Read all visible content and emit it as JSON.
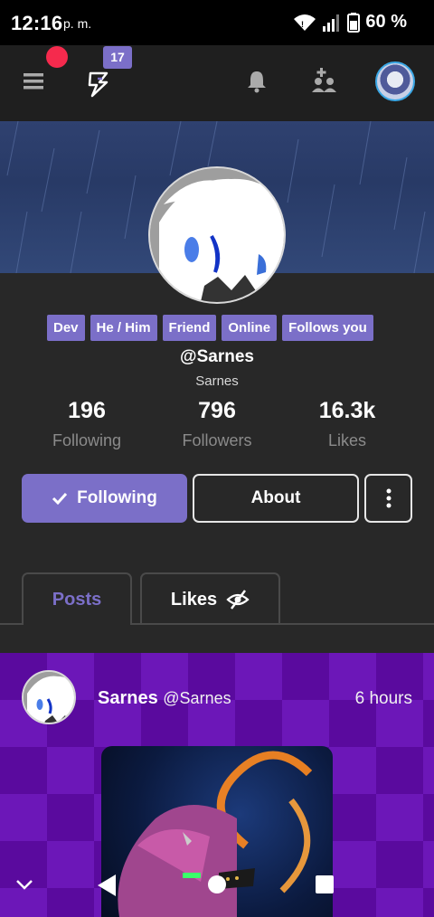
{
  "status_bar": {
    "time": "12:16",
    "ampm": "p. m.",
    "battery": "60 %",
    "icons": [
      "wifi-icon",
      "signal-icon",
      "battery-icon"
    ]
  },
  "topbar": {
    "notification_count": "17",
    "icons": [
      "menu-icon",
      "lightning-icon",
      "bell-icon",
      "add-user-icon",
      "avatar"
    ]
  },
  "profile": {
    "tags": [
      "Dev",
      "He / Him",
      "Friend",
      "Online",
      "Follows you"
    ],
    "handle": "@Sarnes",
    "display_name": "Sarnes",
    "stats": [
      {
        "value": "196",
        "label": "Following"
      },
      {
        "value": "796",
        "label": "Followers"
      },
      {
        "value": "16.3k",
        "label": "Likes"
      }
    ],
    "buttons": {
      "following": "Following",
      "about": "About"
    }
  },
  "tabs": {
    "posts": "Posts",
    "likes": "Likes"
  },
  "post": {
    "author_name": "Sarnes",
    "author_handle": "@Sarnes",
    "time": "6 hours"
  },
  "colors": {
    "accent": "#7b6fc8",
    "notification": "#f52a4d",
    "background": "#282828",
    "topbar": "#1f1f1f",
    "post_background": "#5a0a9e"
  }
}
